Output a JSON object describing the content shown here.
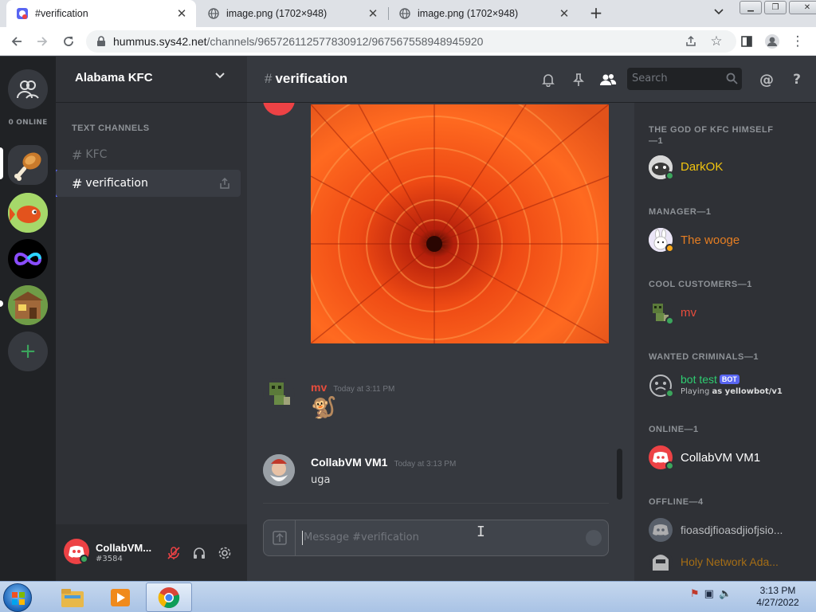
{
  "browser": {
    "tabs": [
      {
        "title": "#verification",
        "active": true
      },
      {
        "title": "image.png (1702×948)",
        "active": false
      },
      {
        "title": "image.png (1702×948)",
        "active": false
      }
    ],
    "url_host": "hummus.sys42.net",
    "url_path": "/channels/965726112577830912/967567558948945920"
  },
  "guilds": {
    "online_count": "0 ONLINE"
  },
  "server": {
    "name": "Alabama KFC",
    "category": "TEXT CHANNELS",
    "channels": [
      {
        "name": "KFC",
        "active": false
      },
      {
        "name": "verification",
        "active": true
      }
    ]
  },
  "user_panel": {
    "name": "CollabVM...",
    "tag": "#3584"
  },
  "chat_header": {
    "channel": "verification",
    "search_placeholder": "Search"
  },
  "messages": [
    {
      "author": "mv",
      "author_color": "#e74c3c",
      "time": "Today at 3:11 PM",
      "content": "🐒"
    },
    {
      "author": "CollabVM VM1",
      "author_color": "#ffffff",
      "time": "Today at 3:13 PM",
      "content": "uga"
    }
  ],
  "composer": {
    "placeholder": "Message #verification"
  },
  "members": {
    "roles": [
      {
        "title": "THE GOD OF KFC HIMSELF —1",
        "members": [
          {
            "name": "DarkOK",
            "color": "#f1c40f",
            "status": "online"
          }
        ]
      },
      {
        "title": "MANAGER—1",
        "members": [
          {
            "name": "The wooge",
            "color": "#e67e22",
            "status": "idle"
          }
        ]
      },
      {
        "title": "COOL CUSTOMERS—1",
        "members": [
          {
            "name": "mv",
            "color": "#e74c3c",
            "status": "online"
          }
        ]
      },
      {
        "title": "WANTED CRIMINALS—1",
        "members": [
          {
            "name": "bot test",
            "color": "#2ecc71",
            "status": "online",
            "badge": "BOT",
            "activity_prefix": "Playing ",
            "activity": "as yellowbot/v1"
          }
        ]
      },
      {
        "title": "ONLINE—1",
        "members": [
          {
            "name": "CollabVM VM1",
            "color": "#ffffff",
            "status": "online"
          }
        ]
      },
      {
        "title": "OFFLINE—4",
        "members": [
          {
            "name": "fioasdjfioasdjiofjsio...",
            "color": "#b9bbbe",
            "status": "offline"
          },
          {
            "name": "Holy Network Ada...",
            "color": "#c27c0e",
            "status": "offline"
          }
        ]
      }
    ]
  },
  "taskbar": {
    "time": "3:13 PM",
    "date": "4/27/2022"
  }
}
